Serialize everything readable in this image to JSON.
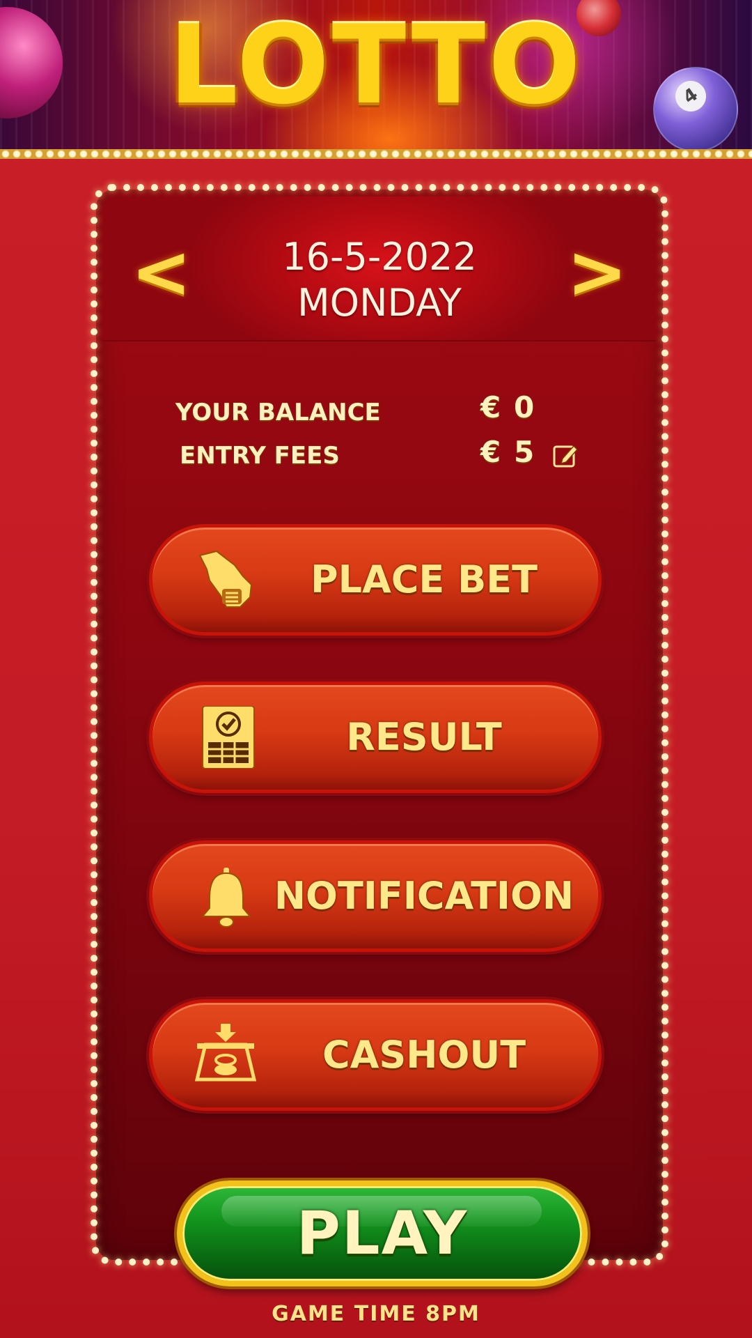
{
  "header": {
    "logo_text": "LOTTO",
    "ball_number": "4"
  },
  "date_nav": {
    "prev_symbol": "<",
    "next_symbol": ">",
    "date": "16-5-2022",
    "weekday": "MONDAY"
  },
  "account": {
    "balance_label": "YOUR BALANCE",
    "balance_currency": "€",
    "balance_value": "0",
    "entry_label": "ENTRY FEES",
    "entry_currency": "€",
    "entry_value": "5",
    "edit_icon": "edit-icon"
  },
  "menu": [
    {
      "label": "PLACE BET",
      "icon": "hand-coin-icon"
    },
    {
      "label": "RESULT",
      "icon": "result-ticket-icon"
    },
    {
      "label": "NOTIFICATION",
      "icon": "bell-icon"
    },
    {
      "label": "CASHOUT",
      "icon": "cashout-icon"
    }
  ],
  "play": {
    "label": "PLAY",
    "game_time": "GAME TIME 8PM"
  },
  "colors": {
    "background_red": "#c81e28",
    "panel_dark_red": "#8a0610",
    "button_orange": "#d73a14",
    "play_green": "#13951e",
    "gold_text": "#ffd21a"
  }
}
